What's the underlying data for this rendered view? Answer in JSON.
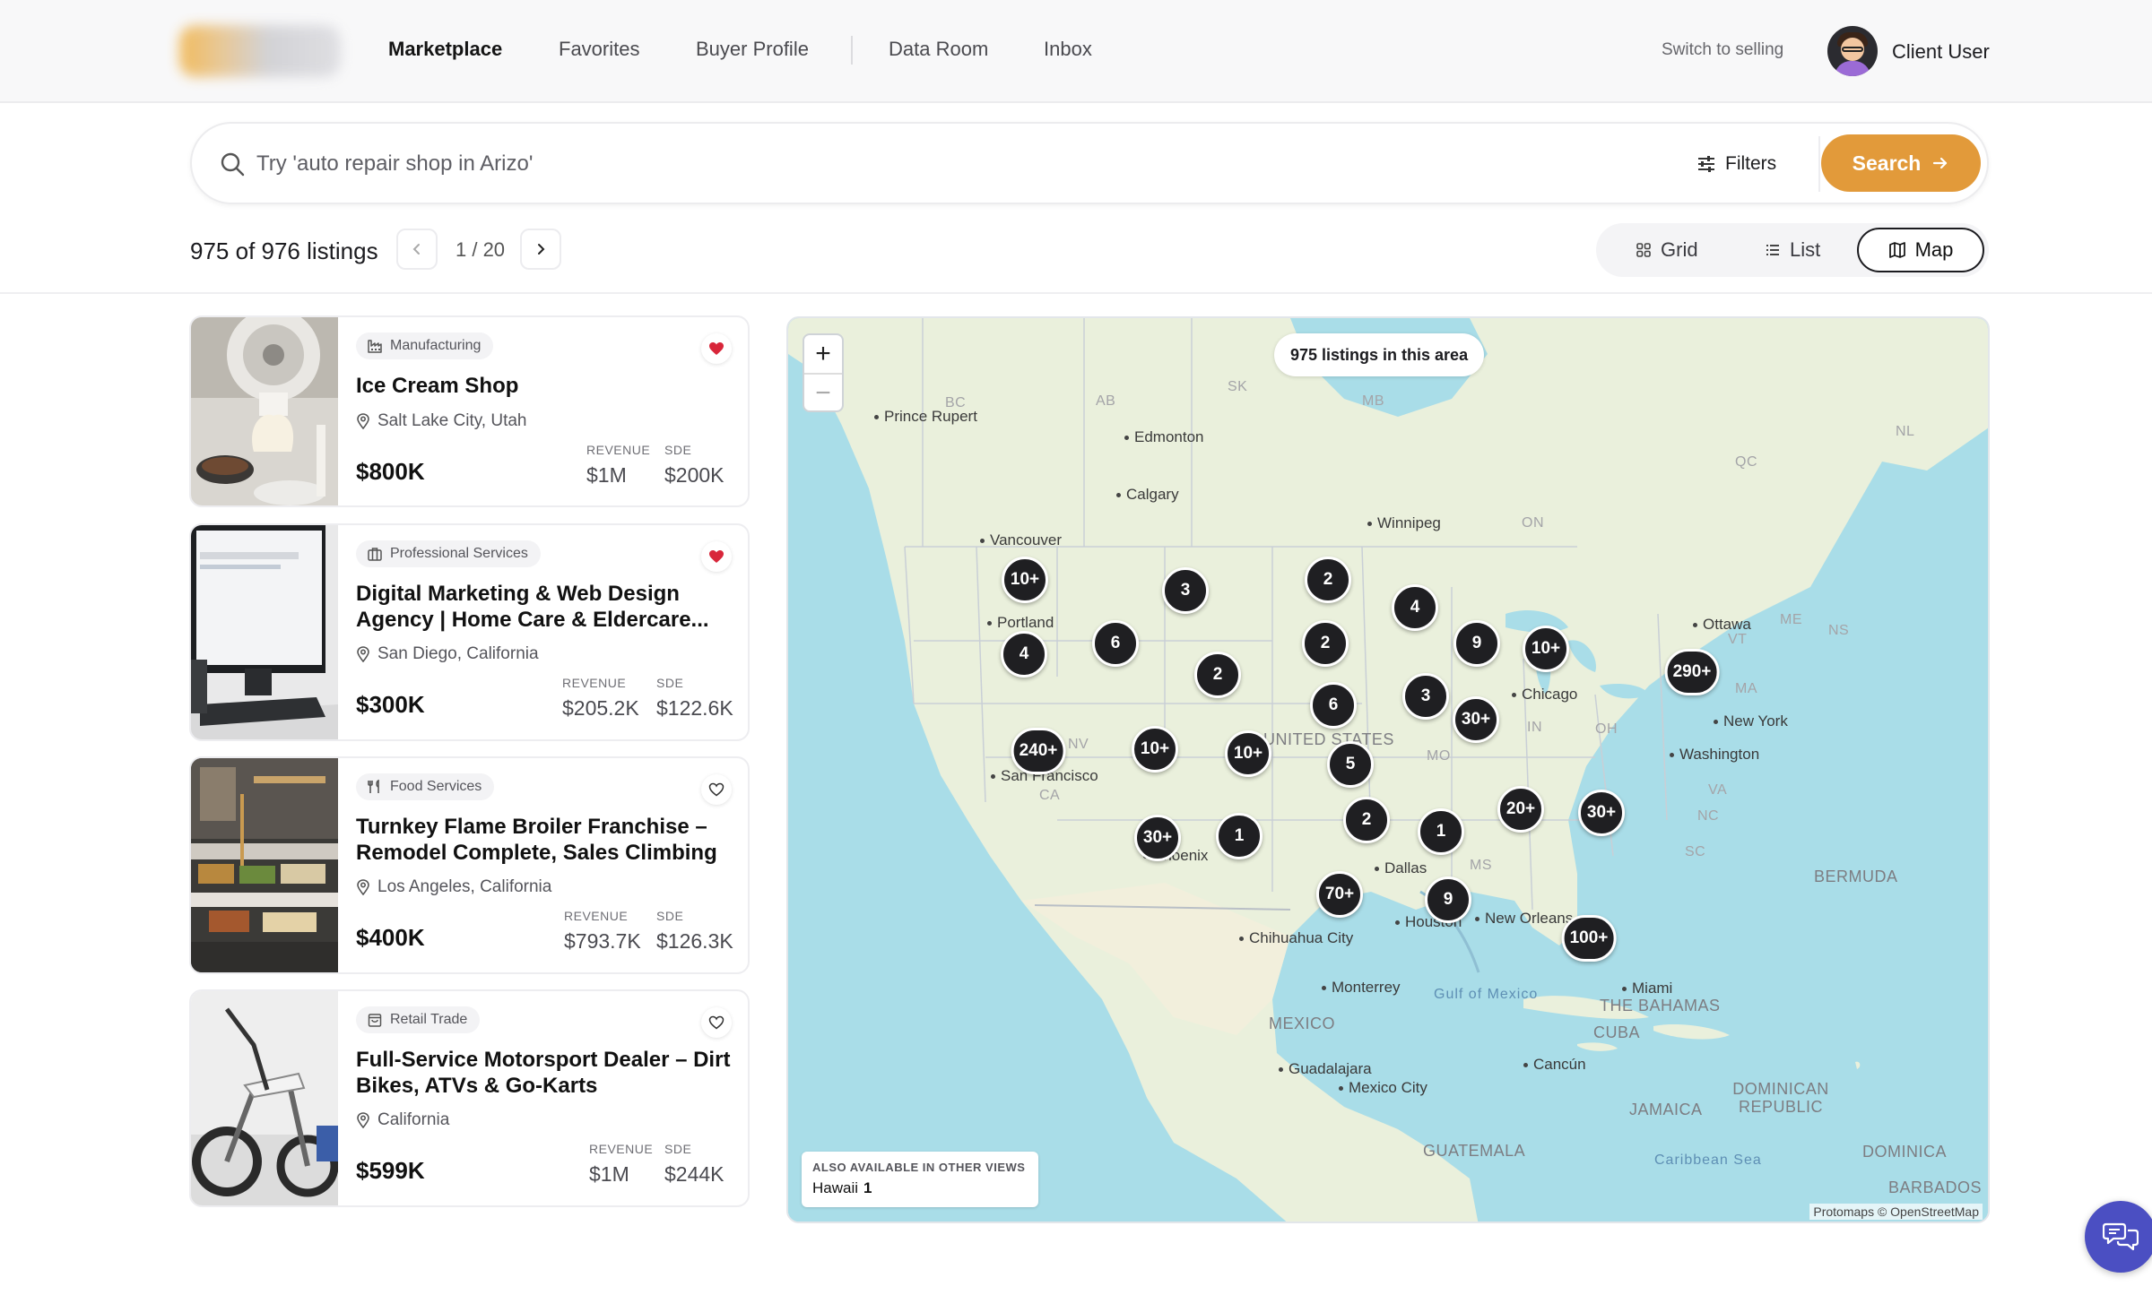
{
  "nav": {
    "links": [
      "Marketplace",
      "Favorites",
      "Buyer Profile",
      "Data Room",
      "Inbox"
    ],
    "switch_label": "Switch to selling",
    "user_name": "Client User"
  },
  "search": {
    "placeholder": "Try 'auto repair shop in Arizo'",
    "filters_label": "Filters",
    "button_label": "Search"
  },
  "results": {
    "count_label": "975 of 976 listings",
    "page": "1 / 20",
    "views": [
      "Grid",
      "List",
      "Map"
    ],
    "active_view": "Map"
  },
  "listings": [
    {
      "category": "Manufacturing",
      "title": "Ice Cream Shop",
      "location": "Salt Lake City, Utah",
      "price": "$800K",
      "revenue_label": "REVENUE",
      "revenue": "$1M",
      "sde_label": "SDE",
      "sde": "$200K",
      "favorited": true
    },
    {
      "category": "Professional Services",
      "title": "Digital Marketing & Web Design Agency | Home Care & Eldercare...",
      "location": "San Diego, California",
      "price": "$300K",
      "revenue_label": "REVENUE",
      "revenue": "$205.2K",
      "sde_label": "SDE",
      "sde": "$122.6K",
      "favorited": true
    },
    {
      "category": "Food Services",
      "title": "Turnkey Flame Broiler Franchise – Remodel Complete, Sales Climbing",
      "location": "Los Angeles, California",
      "price": "$400K",
      "revenue_label": "REVENUE",
      "revenue": "$793.7K",
      "sde_label": "SDE",
      "sde": "$126.3K",
      "favorited": false
    },
    {
      "category": "Retail Trade",
      "title": "Full-Service Motorsport Dealer – Dirt Bikes, ATVs & Go-Karts",
      "location": "California",
      "price": "$599K",
      "revenue_label": "REVENUE",
      "revenue": "$1M",
      "sde_label": "SDE",
      "sde": "$244K",
      "favorited": false
    }
  ],
  "map": {
    "area_label": "975 listings in this area",
    "zoom_in": "+",
    "zoom_out": "−",
    "clusters": [
      "10+",
      "3",
      "2",
      "4",
      "6",
      "4",
      "2",
      "2",
      "9",
      "10+",
      "290+",
      "6",
      "3",
      "30+",
      "240+",
      "10+",
      "10+",
      "5",
      "20+",
      "30+",
      "2",
      "1",
      "30+",
      "1",
      "70+",
      "9",
      "100+"
    ],
    "cities": [
      "Prince Rupert",
      "Edmonton",
      "Calgary",
      "Winnipeg",
      "Vancouver",
      "Portland",
      "Ottawa",
      "Chicago",
      "New York",
      "Washington",
      "San Francisco",
      "Phoenix",
      "Dallas",
      "Houston",
      "New Orleans",
      "Chihuahua City",
      "Miami",
      "Monterrey",
      "Guadalajara",
      "Mexico City",
      "Cancún"
    ],
    "regions": [
      "BC",
      "AB",
      "SK",
      "MB",
      "ON",
      "QC",
      "NL",
      "ME",
      "NS",
      "VT",
      "MA",
      "IN",
      "OH",
      "MO",
      "MS",
      "VA",
      "NC",
      "SC",
      "NV",
      "CA"
    ],
    "countries": [
      "UNITED STATES",
      "MEXICO",
      "CUBA",
      "THE BAHAMAS",
      "BERMUDA",
      "JAMAICA",
      "DOMINICAN REPUBLIC",
      "GUATEMALA",
      "DOMINICA",
      "BARBADOS"
    ],
    "waters": [
      "Gulf of Mexico",
      "Caribbean Sea"
    ],
    "also_label": "ALSO AVAILABLE IN OTHER VIEWS",
    "also_place": "Hawaii",
    "also_count": "1",
    "attribution": "Protomaps © OpenStreetMap"
  },
  "colors": {
    "accent": "#e29a3a",
    "heart_filled": "#d8263a",
    "cluster": "#1f1f22",
    "water": "#a9dde8",
    "land": "#eaf0dc"
  }
}
